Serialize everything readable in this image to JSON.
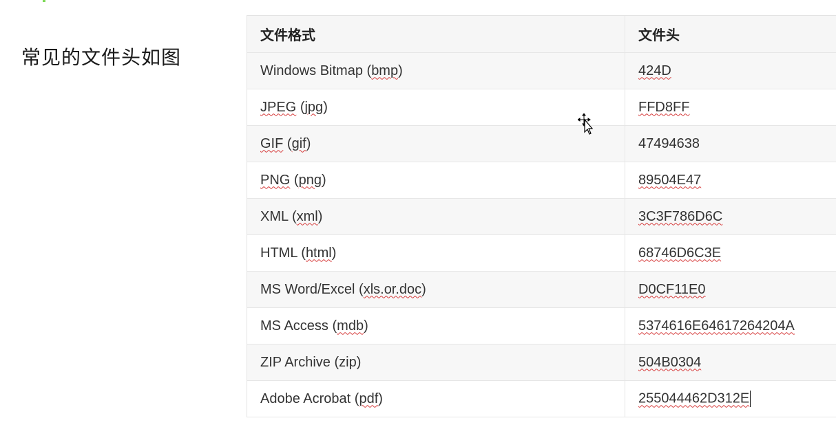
{
  "caption": "常见的文件头如图",
  "table": {
    "headers": [
      "文件格式",
      "文件头"
    ],
    "rows": [
      {
        "format": "Windows Bitmap (bmp)",
        "header": "424D"
      },
      {
        "format": "JPEG (jpg)",
        "header": "FFD8FF"
      },
      {
        "format": "GIF (gif)",
        "header": "47494638"
      },
      {
        "format": "PNG (png)",
        "header": "89504E47"
      },
      {
        "format": "XML (xml)",
        "header": "3C3F786D6C"
      },
      {
        "format": "HTML (html)",
        "header": "68746D6C3E"
      },
      {
        "format": "MS Word/Excel (xls.or.doc)",
        "header": "D0CF11E0"
      },
      {
        "format": "MS Access (mdb)",
        "header": "5374616E64617264204A"
      },
      {
        "format": "ZIP Archive (zip)",
        "header": "504B0304"
      },
      {
        "format": "Adobe Acrobat (pdf)",
        "header": "255044462D312E"
      }
    ]
  },
  "colors": {
    "spellcheck_underline": "#d63b3b",
    "header_background": "#f6f6f6",
    "accent": "#7ed957"
  },
  "icons": {
    "cursor": "move-cursor-icon"
  }
}
